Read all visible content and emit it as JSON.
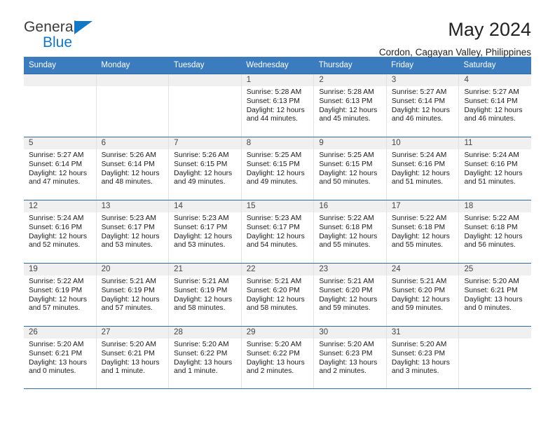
{
  "brand": {
    "name_top": "General",
    "name_bottom": "Blue",
    "accent_color": "#1277c4"
  },
  "header": {
    "title": "May 2024",
    "subtitle": "Cordon, Cagayan Valley, Philippines"
  },
  "calendar": {
    "header_bg": "#3b7cbe",
    "row_border": "#2e6da4",
    "daynum_bg": "#f0f0f0",
    "weekdays": [
      "Sunday",
      "Monday",
      "Tuesday",
      "Wednesday",
      "Thursday",
      "Friday",
      "Saturday"
    ],
    "weeks": [
      [
        {
          "day": "",
          "empty": true
        },
        {
          "day": "",
          "empty": true
        },
        {
          "day": "",
          "empty": true
        },
        {
          "day": "1",
          "sunrise": "Sunrise: 5:28 AM",
          "sunset": "Sunset: 6:13 PM",
          "daylight": "Daylight: 12 hours and 44 minutes."
        },
        {
          "day": "2",
          "sunrise": "Sunrise: 5:28 AM",
          "sunset": "Sunset: 6:13 PM",
          "daylight": "Daylight: 12 hours and 45 minutes."
        },
        {
          "day": "3",
          "sunrise": "Sunrise: 5:27 AM",
          "sunset": "Sunset: 6:14 PM",
          "daylight": "Daylight: 12 hours and 46 minutes."
        },
        {
          "day": "4",
          "sunrise": "Sunrise: 5:27 AM",
          "sunset": "Sunset: 6:14 PM",
          "daylight": "Daylight: 12 hours and 46 minutes."
        }
      ],
      [
        {
          "day": "5",
          "sunrise": "Sunrise: 5:27 AM",
          "sunset": "Sunset: 6:14 PM",
          "daylight": "Daylight: 12 hours and 47 minutes."
        },
        {
          "day": "6",
          "sunrise": "Sunrise: 5:26 AM",
          "sunset": "Sunset: 6:14 PM",
          "daylight": "Daylight: 12 hours and 48 minutes."
        },
        {
          "day": "7",
          "sunrise": "Sunrise: 5:26 AM",
          "sunset": "Sunset: 6:15 PM",
          "daylight": "Daylight: 12 hours and 49 minutes."
        },
        {
          "day": "8",
          "sunrise": "Sunrise: 5:25 AM",
          "sunset": "Sunset: 6:15 PM",
          "daylight": "Daylight: 12 hours and 49 minutes."
        },
        {
          "day": "9",
          "sunrise": "Sunrise: 5:25 AM",
          "sunset": "Sunset: 6:15 PM",
          "daylight": "Daylight: 12 hours and 50 minutes."
        },
        {
          "day": "10",
          "sunrise": "Sunrise: 5:24 AM",
          "sunset": "Sunset: 6:16 PM",
          "daylight": "Daylight: 12 hours and 51 minutes."
        },
        {
          "day": "11",
          "sunrise": "Sunrise: 5:24 AM",
          "sunset": "Sunset: 6:16 PM",
          "daylight": "Daylight: 12 hours and 51 minutes."
        }
      ],
      [
        {
          "day": "12",
          "sunrise": "Sunrise: 5:24 AM",
          "sunset": "Sunset: 6:16 PM",
          "daylight": "Daylight: 12 hours and 52 minutes."
        },
        {
          "day": "13",
          "sunrise": "Sunrise: 5:23 AM",
          "sunset": "Sunset: 6:17 PM",
          "daylight": "Daylight: 12 hours and 53 minutes."
        },
        {
          "day": "14",
          "sunrise": "Sunrise: 5:23 AM",
          "sunset": "Sunset: 6:17 PM",
          "daylight": "Daylight: 12 hours and 53 minutes."
        },
        {
          "day": "15",
          "sunrise": "Sunrise: 5:23 AM",
          "sunset": "Sunset: 6:17 PM",
          "daylight": "Daylight: 12 hours and 54 minutes."
        },
        {
          "day": "16",
          "sunrise": "Sunrise: 5:22 AM",
          "sunset": "Sunset: 6:18 PM",
          "daylight": "Daylight: 12 hours and 55 minutes."
        },
        {
          "day": "17",
          "sunrise": "Sunrise: 5:22 AM",
          "sunset": "Sunset: 6:18 PM",
          "daylight": "Daylight: 12 hours and 55 minutes."
        },
        {
          "day": "18",
          "sunrise": "Sunrise: 5:22 AM",
          "sunset": "Sunset: 6:18 PM",
          "daylight": "Daylight: 12 hours and 56 minutes."
        }
      ],
      [
        {
          "day": "19",
          "sunrise": "Sunrise: 5:22 AM",
          "sunset": "Sunset: 6:19 PM",
          "daylight": "Daylight: 12 hours and 57 minutes."
        },
        {
          "day": "20",
          "sunrise": "Sunrise: 5:21 AM",
          "sunset": "Sunset: 6:19 PM",
          "daylight": "Daylight: 12 hours and 57 minutes."
        },
        {
          "day": "21",
          "sunrise": "Sunrise: 5:21 AM",
          "sunset": "Sunset: 6:19 PM",
          "daylight": "Daylight: 12 hours and 58 minutes."
        },
        {
          "day": "22",
          "sunrise": "Sunrise: 5:21 AM",
          "sunset": "Sunset: 6:20 PM",
          "daylight": "Daylight: 12 hours and 58 minutes."
        },
        {
          "day": "23",
          "sunrise": "Sunrise: 5:21 AM",
          "sunset": "Sunset: 6:20 PM",
          "daylight": "Daylight: 12 hours and 59 minutes."
        },
        {
          "day": "24",
          "sunrise": "Sunrise: 5:21 AM",
          "sunset": "Sunset: 6:20 PM",
          "daylight": "Daylight: 12 hours and 59 minutes."
        },
        {
          "day": "25",
          "sunrise": "Sunrise: 5:20 AM",
          "sunset": "Sunset: 6:21 PM",
          "daylight": "Daylight: 13 hours and 0 minutes."
        }
      ],
      [
        {
          "day": "26",
          "sunrise": "Sunrise: 5:20 AM",
          "sunset": "Sunset: 6:21 PM",
          "daylight": "Daylight: 13 hours and 0 minutes."
        },
        {
          "day": "27",
          "sunrise": "Sunrise: 5:20 AM",
          "sunset": "Sunset: 6:21 PM",
          "daylight": "Daylight: 13 hours and 1 minute."
        },
        {
          "day": "28",
          "sunrise": "Sunrise: 5:20 AM",
          "sunset": "Sunset: 6:22 PM",
          "daylight": "Daylight: 13 hours and 1 minute."
        },
        {
          "day": "29",
          "sunrise": "Sunrise: 5:20 AM",
          "sunset": "Sunset: 6:22 PM",
          "daylight": "Daylight: 13 hours and 2 minutes."
        },
        {
          "day": "30",
          "sunrise": "Sunrise: 5:20 AM",
          "sunset": "Sunset: 6:23 PM",
          "daylight": "Daylight: 13 hours and 2 minutes."
        },
        {
          "day": "31",
          "sunrise": "Sunrise: 5:20 AM",
          "sunset": "Sunset: 6:23 PM",
          "daylight": "Daylight: 13 hours and 3 minutes."
        },
        {
          "day": "",
          "empty": true
        }
      ]
    ]
  }
}
